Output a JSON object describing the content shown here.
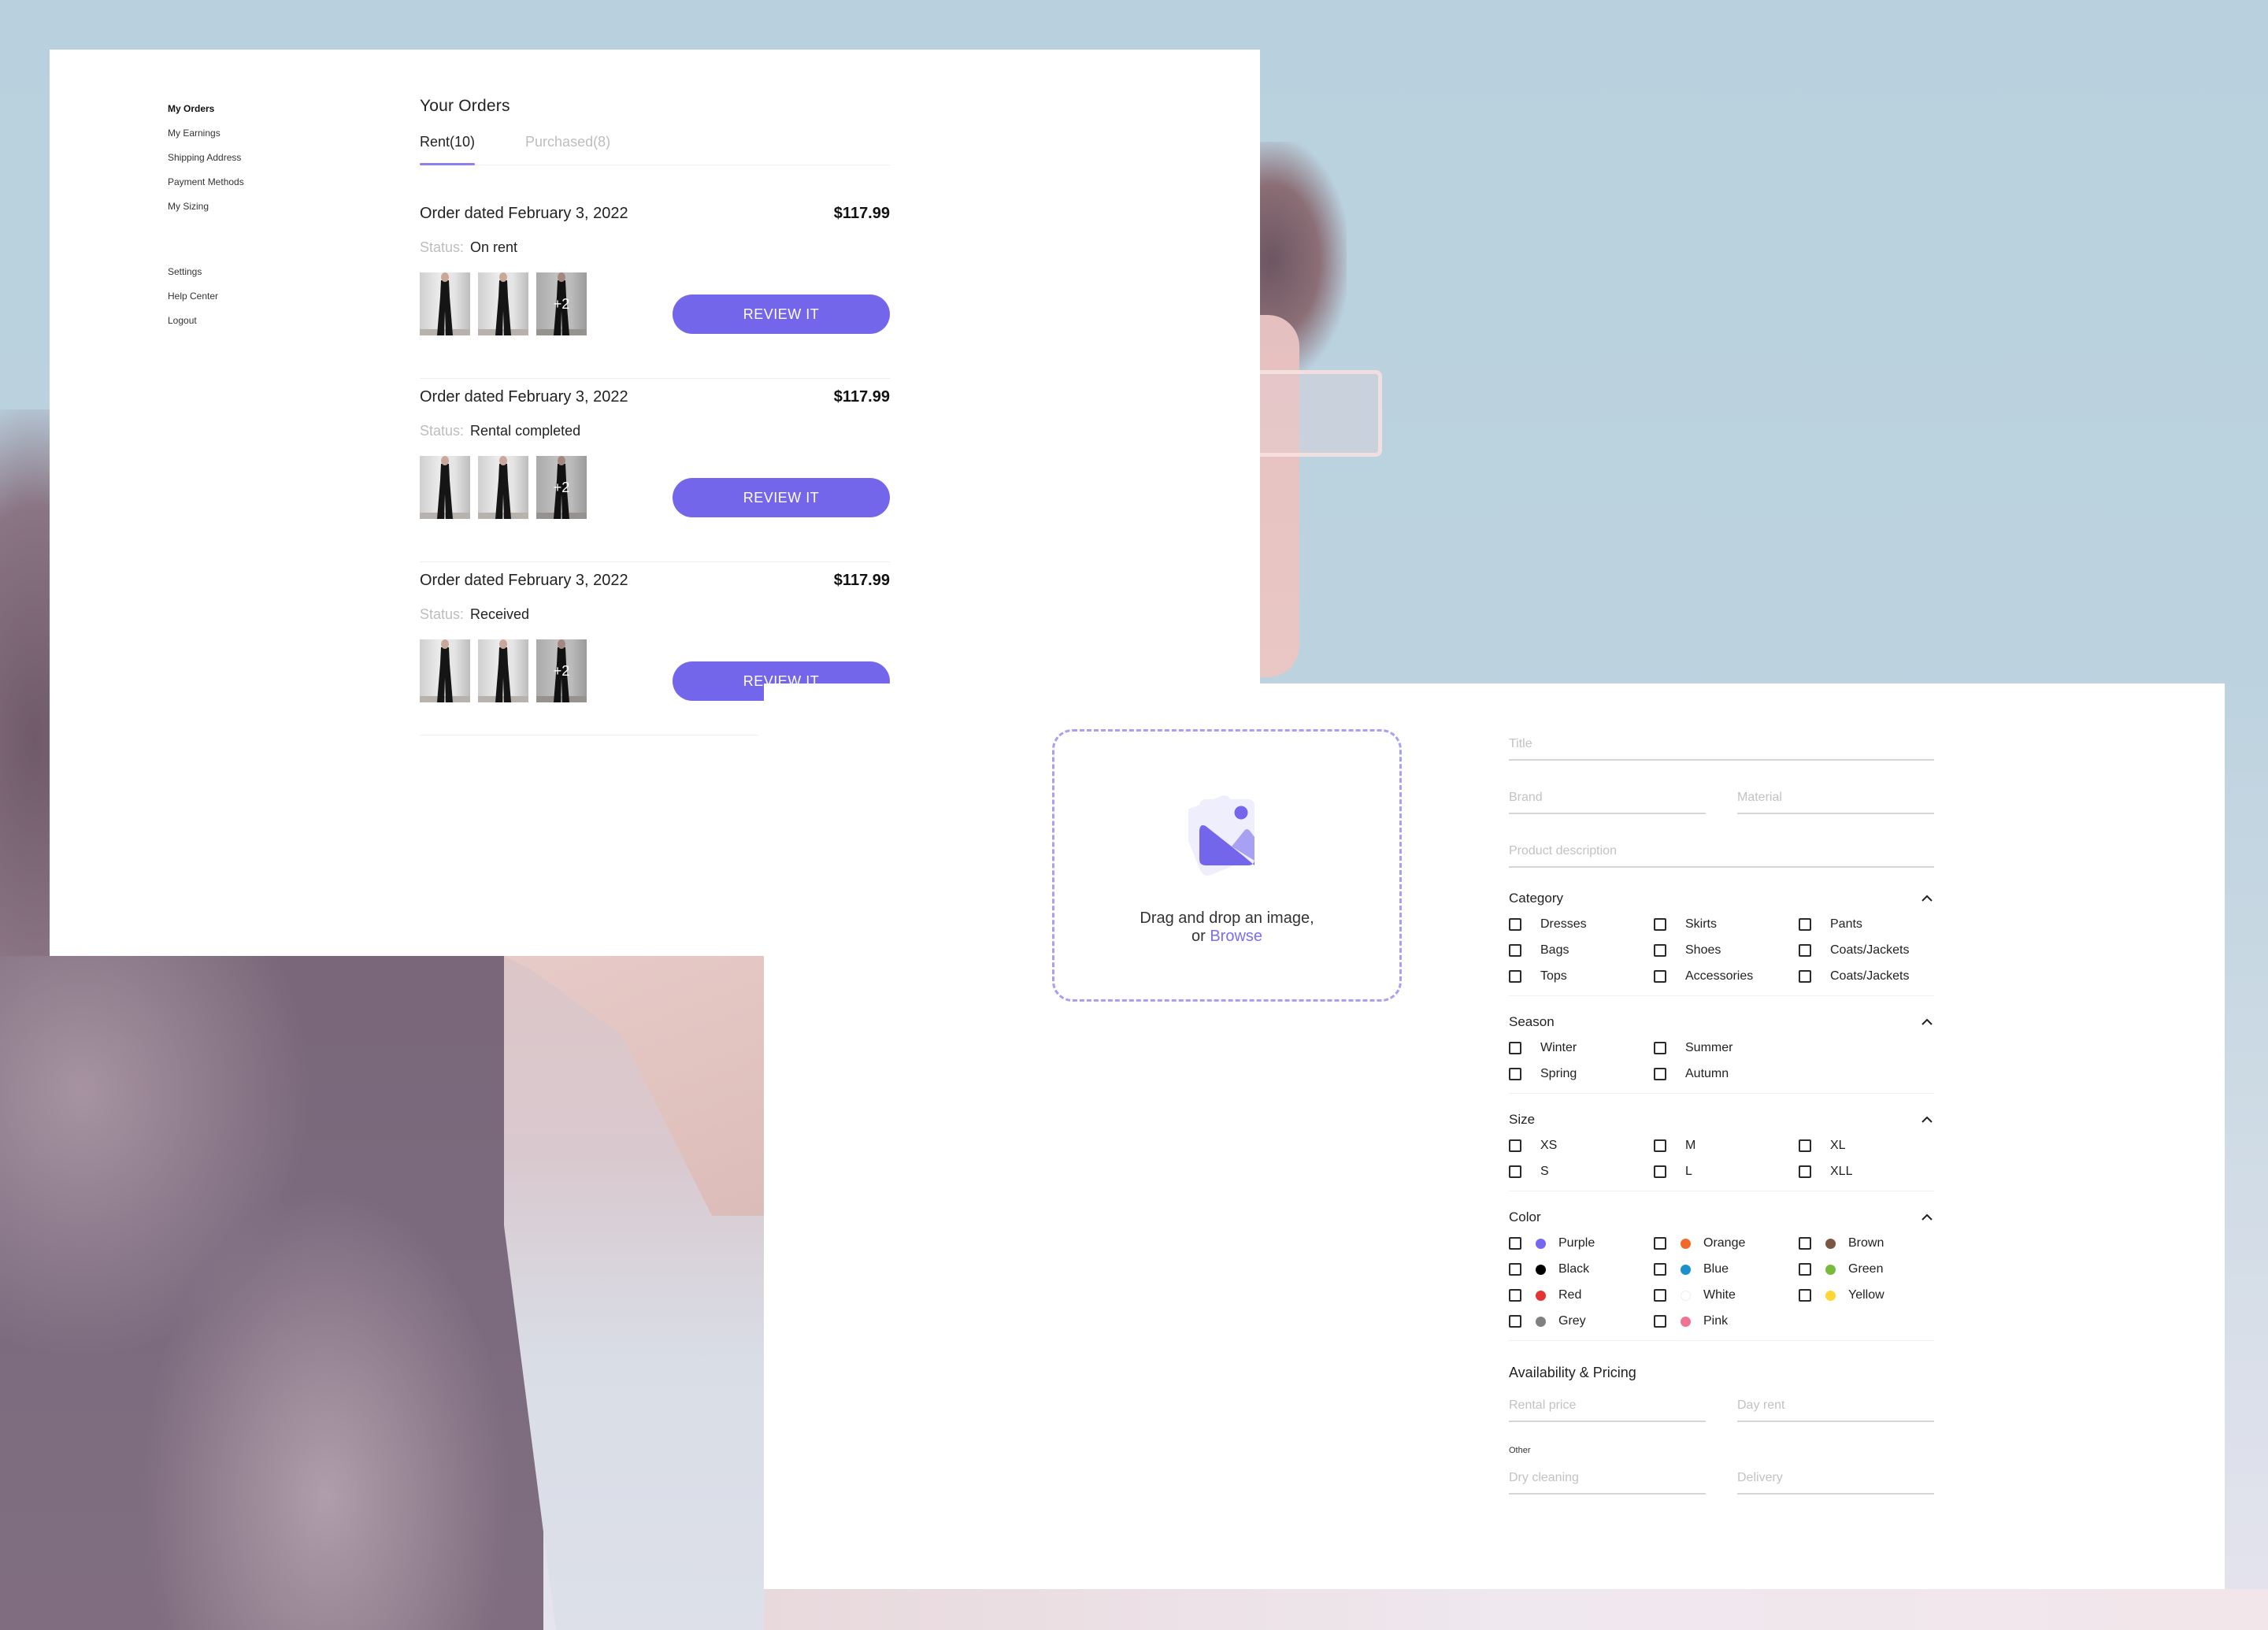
{
  "sidebar": {
    "items": [
      {
        "label": "My Orders",
        "active": true
      },
      {
        "label": "My Earnings"
      },
      {
        "label": "Shipping Address"
      },
      {
        "label": "Payment Methods"
      },
      {
        "label": "My Sizing"
      }
    ],
    "secondary": [
      {
        "label": "Settings"
      },
      {
        "label": "Help Center"
      },
      {
        "label": "Logout"
      }
    ]
  },
  "orders": {
    "title": "Your Orders",
    "tabs": [
      {
        "label": "Rent(10)",
        "active": true
      },
      {
        "label": "Purchased(8)"
      }
    ],
    "status_label": "Status:",
    "review_label": "REVIEW IT",
    "items": [
      {
        "date": "Order dated February 3, 2022",
        "price": "$117.99",
        "status": "On rent",
        "more": "+2"
      },
      {
        "date": "Order dated February 3, 2022",
        "price": "$117.99",
        "status": "Rental completed",
        "more": "+2"
      },
      {
        "date": "Order dated February 3, 2022",
        "price": "$117.99",
        "status": "Received",
        "more": "+2"
      }
    ]
  },
  "upload": {
    "icon": "image-icon",
    "text": "Drag and drop an image,",
    "or": "or",
    "browse": "Browse"
  },
  "form": {
    "title_placeholder": "Title",
    "brand_placeholder": "Brand",
    "material_placeholder": "Material",
    "description_placeholder": "Product description",
    "category": {
      "title": "Category",
      "options": [
        "Dresses",
        "Skirts",
        "Pants",
        "Bags",
        "Shoes",
        "Coats/Jackets",
        "Tops",
        "Accessories",
        "Coats/Jackets"
      ]
    },
    "season": {
      "title": "Season",
      "options": [
        "Winter",
        "Summer",
        "Spring",
        "Autumn"
      ]
    },
    "size": {
      "title": "Size",
      "options": [
        "XS",
        "M",
        "XL",
        "S",
        "L",
        "XLL"
      ]
    },
    "color": {
      "title": "Color",
      "options": [
        {
          "label": "Purple",
          "hex": "#7468ef"
        },
        {
          "label": "Orange",
          "hex": "#f26a2a"
        },
        {
          "label": "Brown",
          "hex": "#7b5640"
        },
        {
          "label": "Black",
          "hex": "#000000"
        },
        {
          "label": "Blue",
          "hex": "#1b8fcf"
        },
        {
          "label": "Green",
          "hex": "#78bb3a"
        },
        {
          "label": "Red",
          "hex": "#e53232"
        },
        {
          "label": "White",
          "hex": "#ffffff"
        },
        {
          "label": "Yellow",
          "hex": "#fdd535"
        },
        {
          "label": "Grey",
          "hex": "#808080"
        },
        {
          "label": "Pink",
          "hex": "#ef7393"
        }
      ]
    },
    "pricing": {
      "title": "Availability & Pricing",
      "rental_price_placeholder": "Rental price",
      "day_rent_placeholder": "Day rent",
      "other_label": "Other",
      "dry_cleaning_placeholder": "Dry cleaning",
      "delivery_placeholder": "Delivery"
    }
  },
  "colors": {
    "accent": "#7366ea",
    "accent_light": "#a7a0f4",
    "muted_text": "#bdbdbd"
  }
}
